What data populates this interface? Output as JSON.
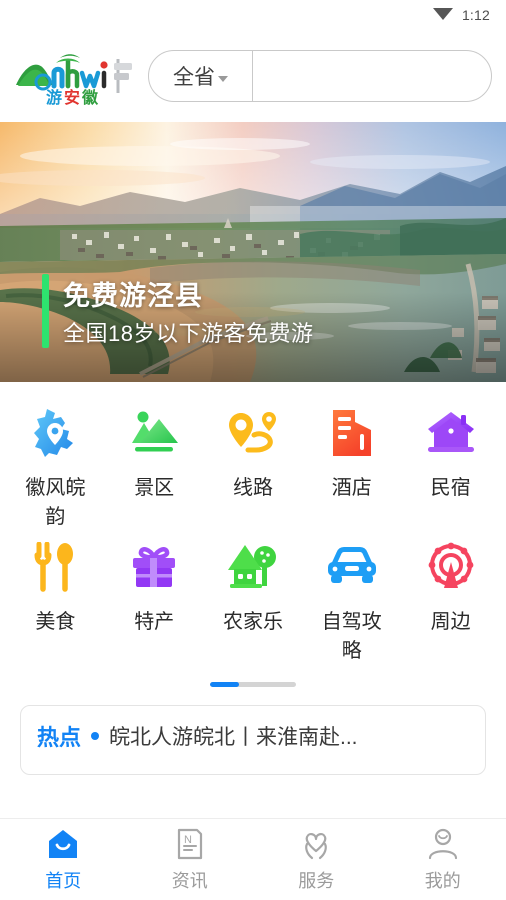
{
  "status_bar": {
    "time": "1:12",
    "signal_icon": "wifi-signal-icon"
  },
  "header": {
    "logo_alt": "游安徽",
    "logo_latin": "Anhui",
    "logo_cn": "游安徽",
    "search": {
      "region_label": "全省",
      "region_caret_icon": "chevron-down-icon",
      "input_value": "",
      "input_placeholder": ""
    }
  },
  "banner": {
    "title": "免费游泾县",
    "subtitle": "全国18岁以下游客免费游",
    "accent_color": "#2ee36f",
    "scene": "aerial-river-town-sunset"
  },
  "grid": {
    "items": [
      {
        "label": "徽风皖韵",
        "icon": "anhui-map-pin-icon",
        "color": "#2da8f0"
      },
      {
        "label": "景区",
        "icon": "mountains-icon",
        "color": "#4cd964"
      },
      {
        "label": "线路",
        "icon": "route-pins-icon",
        "color": "#fbb515"
      },
      {
        "label": "酒店",
        "icon": "hotel-building-icon",
        "color": "#f8542e"
      },
      {
        "label": "民宿",
        "icon": "homestay-house-icon",
        "color": "#9b4dff"
      },
      {
        "label": "美食",
        "icon": "fork-spoon-icon",
        "color": "#fbb515"
      },
      {
        "label": "特产",
        "icon": "gift-box-icon",
        "color": "#9b4dff"
      },
      {
        "label": "农家乐",
        "icon": "farmhouse-tree-icon",
        "color": "#3dd63d"
      },
      {
        "label": "自驾攻略",
        "icon": "car-icon",
        "color": "#1e9ef5"
      },
      {
        "label": "周边",
        "icon": "ferris-wheel-icon",
        "color": "#f5445f"
      }
    ],
    "pager": {
      "pages": 3,
      "active_page": 1,
      "active_color": "#1283f5",
      "track_color": "#d4d4d4"
    }
  },
  "news_card": {
    "tag": "热点",
    "dot_icon": "blue-dot-icon",
    "headline": "皖北人游皖北丨来淮南赴..."
  },
  "bottom_nav": {
    "active_color": "#1283f5",
    "inactive_color": "#9b9b9b",
    "items": [
      {
        "label": "首页",
        "icon": "home-icon",
        "active": true
      },
      {
        "label": "资讯",
        "icon": "news-icon",
        "active": false
      },
      {
        "label": "服务",
        "icon": "service-heart-hands-icon",
        "active": false
      },
      {
        "label": "我的",
        "icon": "user-profile-icon",
        "active": false
      }
    ]
  }
}
